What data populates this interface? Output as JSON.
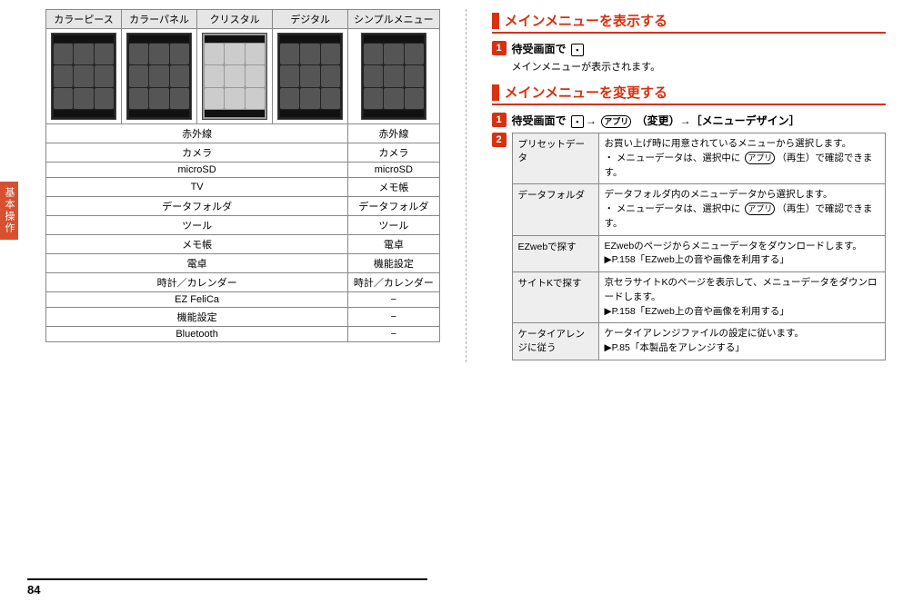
{
  "side_tab": "基本操作",
  "page_number": "84",
  "left": {
    "headers": [
      "カラーピース",
      "カラーパネル",
      "クリスタル",
      "デジタル",
      "シンプルメニュー"
    ],
    "left_rows": [
      "赤外線",
      "カメラ",
      "microSD",
      "TV",
      "データフォルダ",
      "ツール",
      "メモ帳",
      "電卓",
      "時計／カレンダー",
      "EZ FeliCa",
      "機能設定",
      "Bluetooth"
    ],
    "right_rows": [
      "赤外線",
      "カメラ",
      "microSD",
      "メモ帳",
      "データフォルダ",
      "ツール",
      "電卓",
      "機能設定",
      "時計／カレンダー",
      "−",
      "−",
      "−"
    ]
  },
  "right": {
    "section1_title": "メインメニューを表示する",
    "section1_step1": "待受画面で",
    "section1_note": "メインメニューが表示されます。",
    "section2_title": "メインメニューを変更する",
    "section2_step1_a": "待受画面で",
    "section2_step1_b": "（変更）→［メニューデザイン］",
    "key_app": "アプリ",
    "options": [
      {
        "k": "プリセットデータ",
        "v": "お買い上げ時に用意されているメニューから選択します。\n・ メニューデータは、選択中に アプリ（再生）で確認できます。"
      },
      {
        "k": "データフォルダ",
        "v": "データフォルダ内のメニューデータから選択します。\n・ メニューデータは、選択中に アプリ（再生）で確認できます。"
      },
      {
        "k": "EZwebで探す",
        "v": "EZwebのページからメニューデータをダウンロードします。\n▶P.158「EZweb上の音や画像を利用する」"
      },
      {
        "k": "サイトKで探す",
        "v": "京セラサイトKのページを表示して、メニューデータをダウンロードします。\n▶P.158「EZweb上の音や画像を利用する」"
      },
      {
        "k": "ケータイアレンジに従う",
        "v": "ケータイアレンジファイルの設定に従います。\n▶P.85「本製品をアレンジする」"
      }
    ]
  }
}
